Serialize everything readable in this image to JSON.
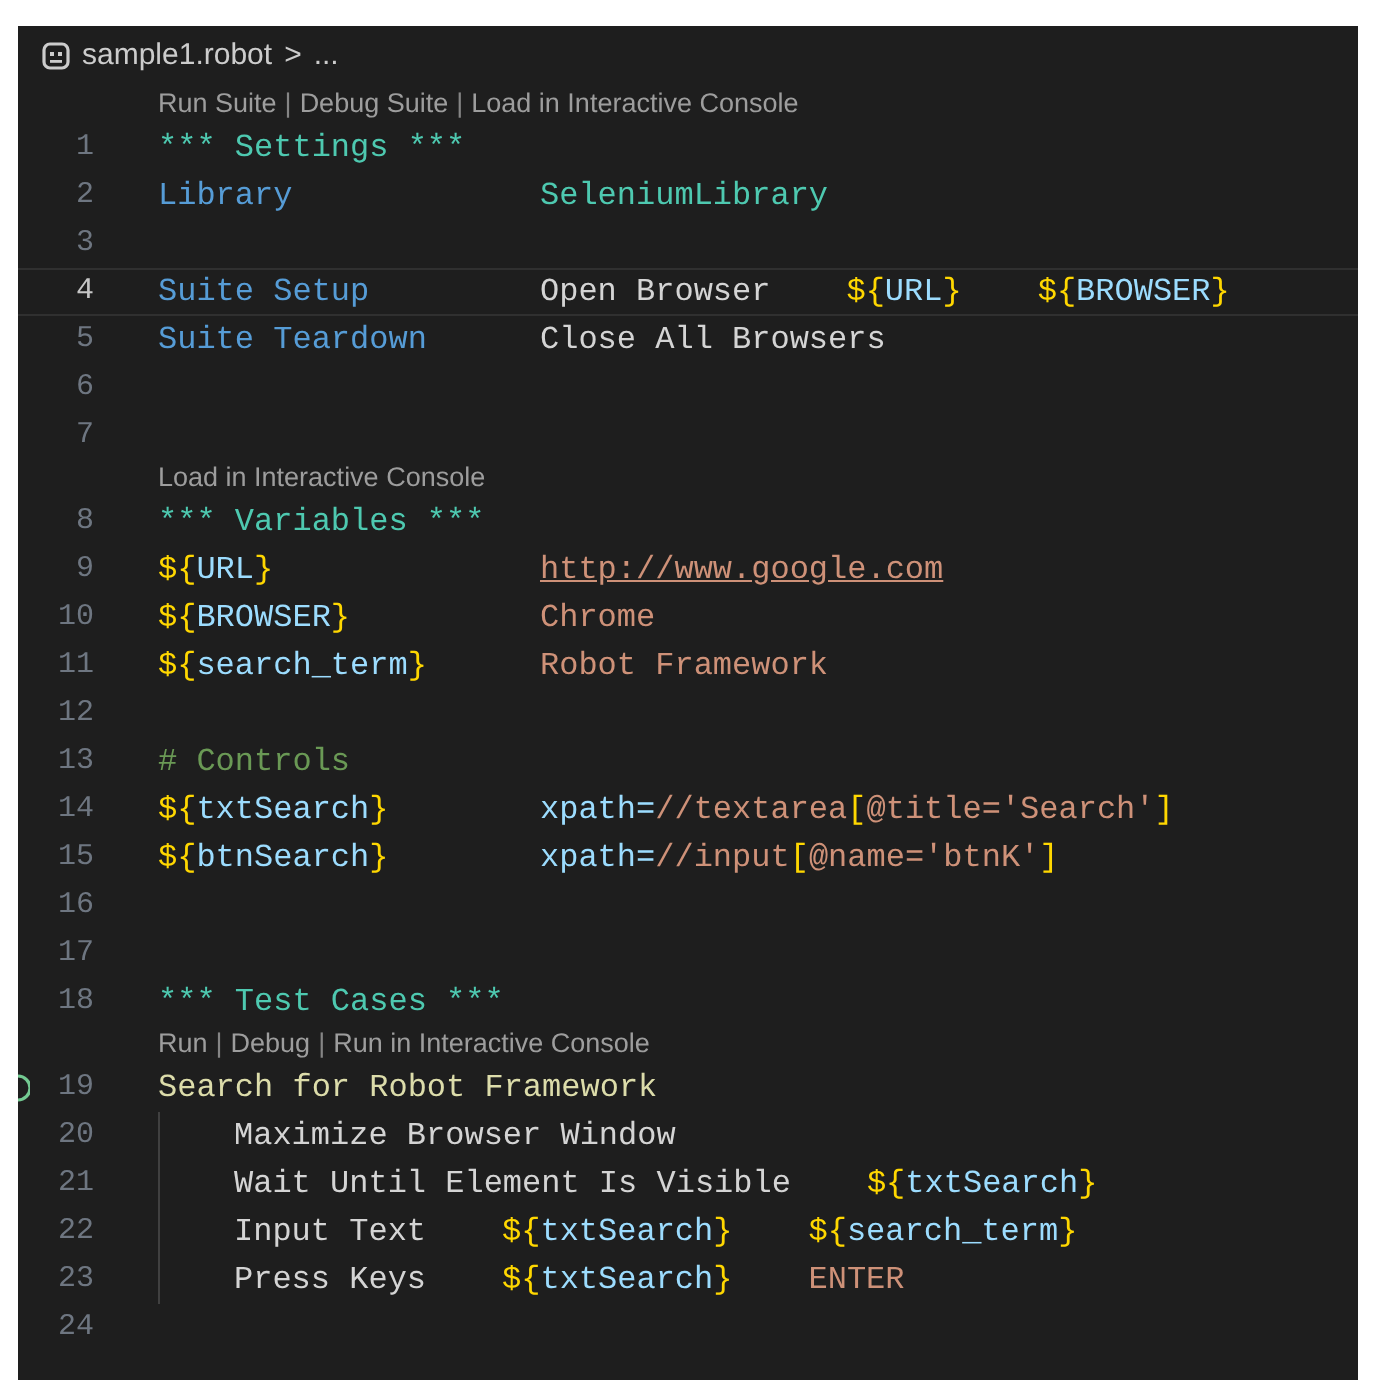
{
  "breadcrumb": {
    "file": "sample1.robot",
    "separator": ">",
    "more": "..."
  },
  "lines": [
    {
      "kind": "lens",
      "items": [
        {
          "kind": "link",
          "text": "Run Suite"
        },
        {
          "kind": "sep",
          "text": "|"
        },
        {
          "kind": "link",
          "text": "Debug Suite"
        },
        {
          "kind": "sep",
          "text": "|"
        },
        {
          "kind": "link",
          "text": "Load in Interactive Console"
        }
      ]
    },
    {
      "kind": "code",
      "number": "1",
      "current": false,
      "run_icon": false,
      "indent": false,
      "cells": [
        [
          {
            "kind": "header",
            "text": "*** Settings ***"
          }
        ]
      ]
    },
    {
      "kind": "code",
      "number": "2",
      "current": false,
      "run_icon": false,
      "indent": false,
      "cells": [
        [
          {
            "kind": "setting",
            "text": "Library"
          }
        ],
        [
          {
            "kind": "library",
            "text": "SeleniumLibrary"
          }
        ]
      ]
    },
    {
      "kind": "code",
      "number": "3",
      "current": false,
      "run_icon": false,
      "indent": false
    },
    {
      "kind": "code",
      "number": "4",
      "current": true,
      "run_icon": false,
      "indent": false,
      "cells": [
        [
          {
            "kind": "setting",
            "text": "Suite Setup"
          }
        ],
        [
          {
            "kind": "keyword",
            "text": "Open Browser"
          }
        ],
        [
          {
            "kind": "brace",
            "text": "${"
          },
          {
            "kind": "varname",
            "text": "URL"
          },
          {
            "kind": "brace",
            "text": "}"
          }
        ],
        [
          {
            "kind": "brace",
            "text": "${"
          },
          {
            "kind": "varname",
            "text": "BROWSER"
          },
          {
            "kind": "brace",
            "text": "}"
          }
        ]
      ]
    },
    {
      "kind": "code",
      "number": "5",
      "current": false,
      "run_icon": false,
      "indent": false,
      "cells": [
        [
          {
            "kind": "setting",
            "text": "Suite Teardown"
          }
        ],
        [
          {
            "kind": "keyword",
            "text": "Close All Browsers"
          }
        ]
      ]
    },
    {
      "kind": "code",
      "number": "6",
      "current": false,
      "run_icon": false,
      "indent": false
    },
    {
      "kind": "code",
      "number": "7",
      "current": false,
      "run_icon": false,
      "indent": false
    },
    {
      "kind": "lens",
      "items": [
        {
          "kind": "link",
          "text": "Load in Interactive Console"
        }
      ]
    },
    {
      "kind": "code",
      "number": "8",
      "current": false,
      "run_icon": false,
      "indent": false,
      "cells": [
        [
          {
            "kind": "header",
            "text": "*** Variables ***"
          }
        ]
      ]
    },
    {
      "kind": "code",
      "number": "9",
      "current": false,
      "run_icon": false,
      "indent": false,
      "cells": [
        [
          {
            "kind": "brace",
            "text": "${"
          },
          {
            "kind": "varname",
            "text": "URL"
          },
          {
            "kind": "brace",
            "text": "}"
          }
        ],
        [
          {
            "kind": "url",
            "text": "http://www.google.com"
          }
        ]
      ]
    },
    {
      "kind": "code",
      "number": "10",
      "current": false,
      "run_icon": false,
      "indent": false,
      "cells": [
        [
          {
            "kind": "brace",
            "text": "${"
          },
          {
            "kind": "varname",
            "text": "BROWSER"
          },
          {
            "kind": "brace",
            "text": "}"
          }
        ],
        [
          {
            "kind": "value",
            "text": "Chrome"
          }
        ]
      ]
    },
    {
      "kind": "code",
      "number": "11",
      "current": false,
      "run_icon": false,
      "indent": false,
      "cells": [
        [
          {
            "kind": "brace",
            "text": "${"
          },
          {
            "kind": "varname",
            "text": "search_term"
          },
          {
            "kind": "brace",
            "text": "}"
          }
        ],
        [
          {
            "kind": "value",
            "text": "Robot Framework"
          }
        ]
      ]
    },
    {
      "kind": "code",
      "number": "12",
      "current": false,
      "run_icon": false,
      "indent": false
    },
    {
      "kind": "code",
      "number": "13",
      "current": false,
      "run_icon": false,
      "indent": false,
      "cells": [
        [
          {
            "kind": "comment",
            "text": "# Controls"
          }
        ]
      ]
    },
    {
      "kind": "code",
      "number": "14",
      "current": false,
      "run_icon": false,
      "indent": false,
      "cells": [
        [
          {
            "kind": "brace",
            "text": "${"
          },
          {
            "kind": "varname",
            "text": "txtSearch"
          },
          {
            "kind": "brace",
            "text": "}"
          }
        ],
        [
          {
            "kind": "varname",
            "text": "xpath="
          },
          {
            "kind": "value",
            "text": "//textarea"
          },
          {
            "kind": "brace",
            "text": "["
          },
          {
            "kind": "value",
            "text": "@title='Search'"
          },
          {
            "kind": "brace",
            "text": "]"
          }
        ]
      ]
    },
    {
      "kind": "code",
      "number": "15",
      "current": false,
      "run_icon": false,
      "indent": false,
      "cells": [
        [
          {
            "kind": "brace",
            "text": "${"
          },
          {
            "kind": "varname",
            "text": "btnSearch"
          },
          {
            "kind": "brace",
            "text": "}"
          }
        ],
        [
          {
            "kind": "varname",
            "text": "xpath="
          },
          {
            "kind": "value",
            "text": "//input"
          },
          {
            "kind": "brace",
            "text": "["
          },
          {
            "kind": "value",
            "text": "@name='btnK'"
          },
          {
            "kind": "brace",
            "text": "]"
          }
        ]
      ]
    },
    {
      "kind": "code",
      "number": "16",
      "current": false,
      "run_icon": false,
      "indent": false
    },
    {
      "kind": "code",
      "number": "17",
      "current": false,
      "run_icon": false,
      "indent": false
    },
    {
      "kind": "code",
      "number": "18",
      "current": false,
      "run_icon": false,
      "indent": false,
      "cells": [
        [
          {
            "kind": "header",
            "text": "*** Test Cases ***"
          }
        ]
      ]
    },
    {
      "kind": "lens",
      "items": [
        {
          "kind": "link",
          "text": "Run"
        },
        {
          "kind": "sep",
          "text": "|"
        },
        {
          "kind": "link",
          "text": "Debug"
        },
        {
          "kind": "sep",
          "text": "|"
        },
        {
          "kind": "link",
          "text": "Run in Interactive Console"
        }
      ]
    },
    {
      "kind": "code",
      "number": "19",
      "current": false,
      "run_icon": true,
      "indent": false,
      "cells": [
        [
          {
            "kind": "testname",
            "text": "Search for Robot Framework"
          }
        ]
      ]
    },
    {
      "kind": "code",
      "number": "20",
      "current": false,
      "run_icon": false,
      "indent": true,
      "cells": [
        [
          {
            "kind": "keyword",
            "text": "Maximize Browser Window"
          }
        ]
      ]
    },
    {
      "kind": "code",
      "number": "21",
      "current": false,
      "run_icon": false,
      "indent": true,
      "cells": [
        [
          {
            "kind": "keyword",
            "text": "Wait Until Element Is Visible"
          }
        ],
        [
          {
            "kind": "brace",
            "text": "${"
          },
          {
            "kind": "varname",
            "text": "txtSearch"
          },
          {
            "kind": "brace",
            "text": "}"
          }
        ]
      ]
    },
    {
      "kind": "code",
      "number": "22",
      "current": false,
      "run_icon": false,
      "indent": true,
      "cells": [
        [
          {
            "kind": "keyword",
            "text": "Input Text"
          }
        ],
        [
          {
            "kind": "brace",
            "text": "${"
          },
          {
            "kind": "varname",
            "text": "txtSearch"
          },
          {
            "kind": "brace",
            "text": "}"
          }
        ],
        [
          {
            "kind": "brace",
            "text": "${"
          },
          {
            "kind": "varname",
            "text": "search_term"
          },
          {
            "kind": "brace",
            "text": "}"
          }
        ]
      ]
    },
    {
      "kind": "code",
      "number": "23",
      "current": false,
      "run_icon": false,
      "indent": true,
      "cells": [
        [
          {
            "kind": "keyword",
            "text": "Press Keys"
          }
        ],
        [
          {
            "kind": "brace",
            "text": "${"
          },
          {
            "kind": "varname",
            "text": "txtSearch"
          },
          {
            "kind": "brace",
            "text": "}"
          }
        ],
        [
          {
            "kind": "value",
            "text": "ENTER"
          }
        ]
      ]
    },
    {
      "kind": "code",
      "number": "24",
      "current": false,
      "run_icon": false,
      "indent": false
    }
  ]
}
